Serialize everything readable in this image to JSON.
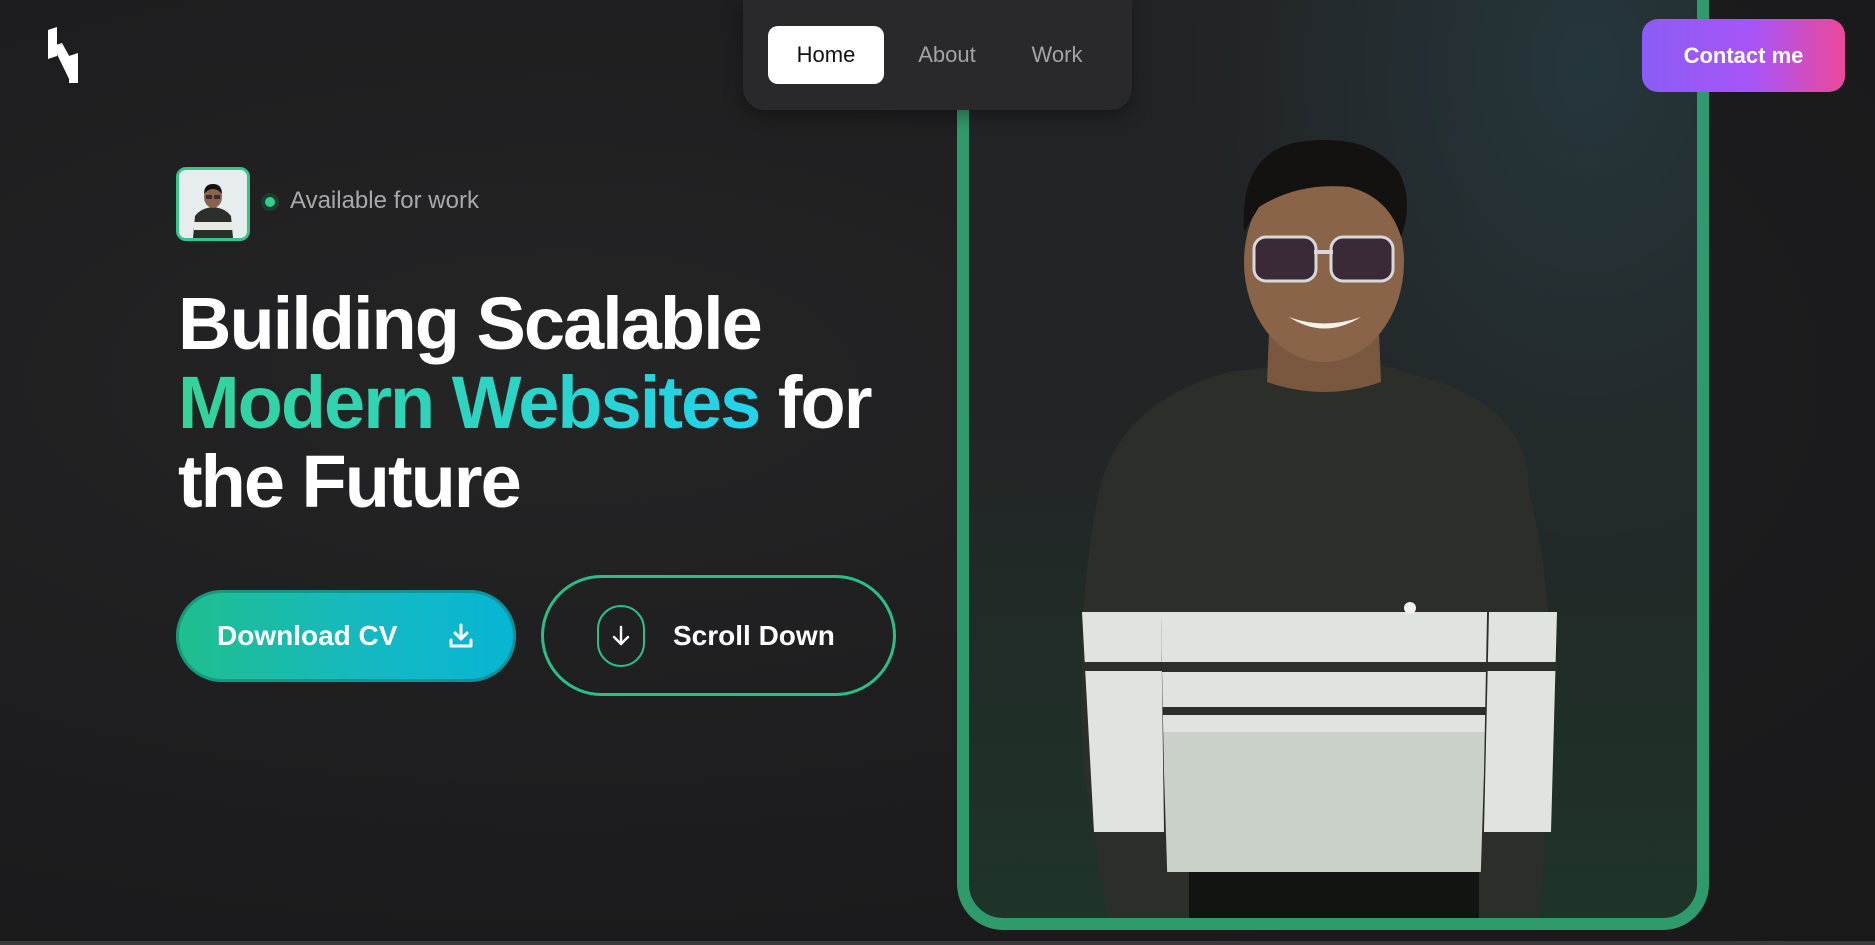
{
  "brand": {
    "logo_icon": "brand-logo-icon"
  },
  "nav": {
    "items": [
      {
        "label": "Home",
        "active": true
      },
      {
        "label": "About",
        "active": false
      },
      {
        "label": "Work",
        "active": false
      }
    ]
  },
  "header": {
    "contact_label": "Contact me"
  },
  "hero": {
    "status_text": "Available for work",
    "headline": {
      "line1": "Building Scalable",
      "highlight": "Modern Websites",
      "after_highlight": "for",
      "line3": "the Future"
    },
    "download_label": "Download CV",
    "scroll_label": "Scroll Down"
  },
  "colors": {
    "background": "#1d1d1f",
    "accent_green": "#2f9a6b",
    "gradient_start": "#34d399",
    "gradient_end": "#22d3ee",
    "contact_gradient_start": "#8b5cf6",
    "contact_gradient_end": "#ec4899"
  },
  "icons": {
    "download": "download-icon",
    "scroll": "arrow-down-icon",
    "status": "status-dot-icon"
  }
}
